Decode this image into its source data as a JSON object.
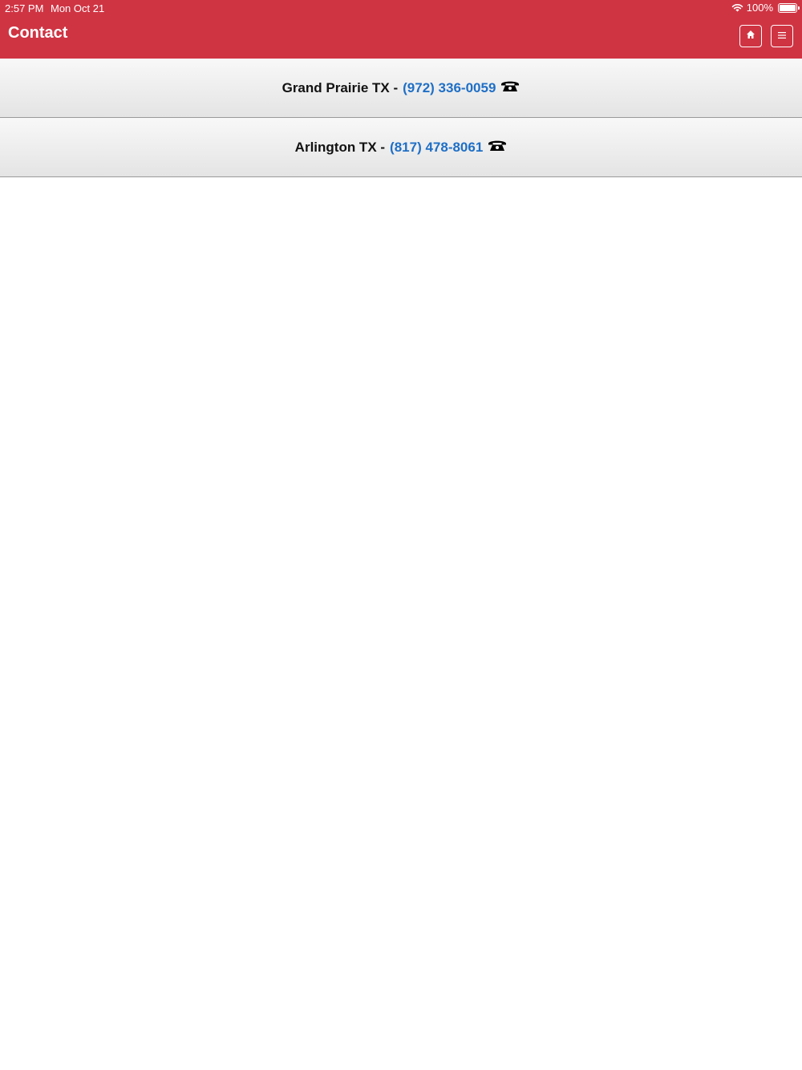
{
  "status_bar": {
    "time": "2:57 PM",
    "date": "Mon Oct 21",
    "battery": "100%"
  },
  "header": {
    "title": "Contact",
    "buttons": [
      {
        "icon": "home-icon"
      },
      {
        "icon": "menu-icon"
      }
    ]
  },
  "contacts": [
    {
      "city": "Grand Prairie TX -",
      "phone": "(972) 336-0059",
      "icon": "telephone-icon"
    },
    {
      "city": "Arlington TX -",
      "phone": "(817) 478-8061",
      "icon": "telephone-icon"
    }
  ],
  "colors": {
    "header_bg": "#cf3443",
    "link": "#1f6fc6"
  }
}
